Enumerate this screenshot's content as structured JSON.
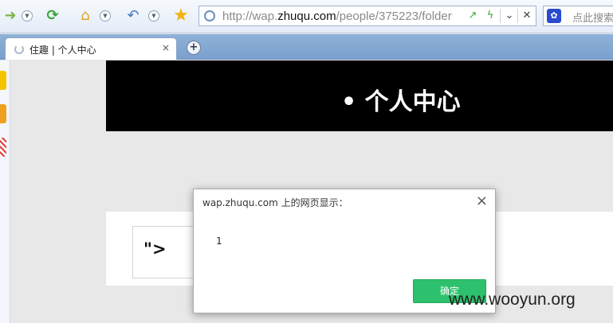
{
  "browser": {
    "address_url_prefix": "http://wap.",
    "address_url_domain": "zhuqu.com",
    "address_url_path": "/people/375223/folder",
    "search_placeholder": "点此搜索"
  },
  "tab": {
    "title": "住趣 | 个人中心",
    "close": "×",
    "new_tab": "+"
  },
  "page": {
    "header_title": "• 个人中心",
    "card_text": "\">"
  },
  "dialog": {
    "title": "wap.zhuqu.com 上的网页显示：",
    "message": "1",
    "ok_label": "确定",
    "close": "×"
  },
  "watermark": "www.wooyun.org",
  "colors": {
    "ok_button": "#2ec16d",
    "header_bg": "#000000",
    "tabbar": "#8fb1d8"
  },
  "icons": [
    "forward-icon",
    "refresh-icon",
    "home-icon",
    "undo-icon",
    "star-icon",
    "share-icon",
    "flash-icon",
    "dropdown-icon",
    "stop-icon",
    "baidu-icon"
  ]
}
